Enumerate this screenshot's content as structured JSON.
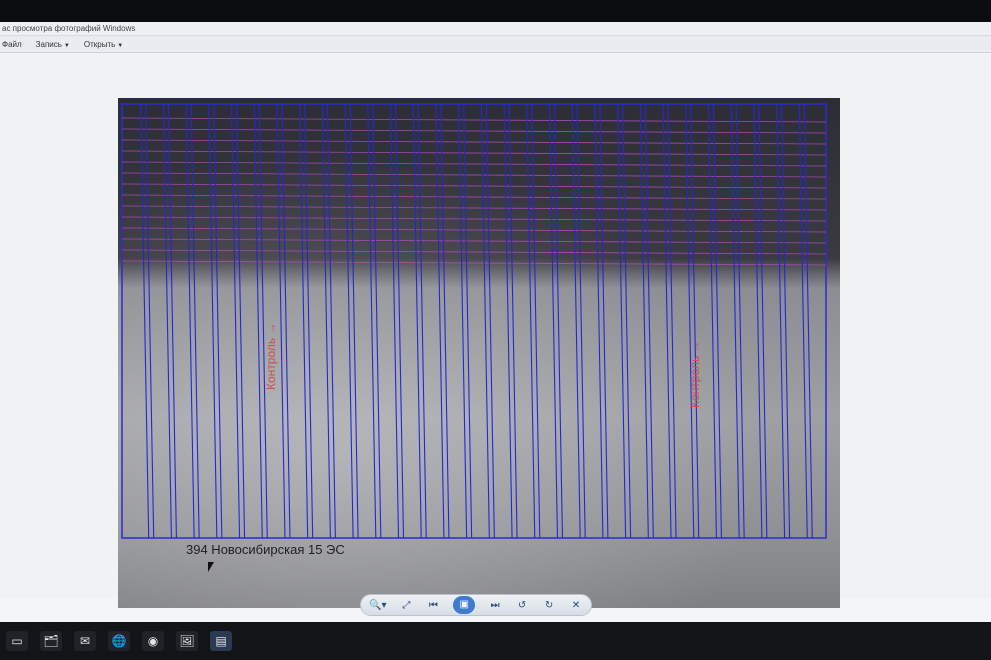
{
  "window": {
    "title": "ас просмотра фотографий Windows",
    "menu": [
      {
        "label": "Файл"
      },
      {
        "label": "Запись"
      },
      {
        "label": "Открыть"
      }
    ]
  },
  "photo": {
    "caption": "394 Новосибирская 15 ЭС",
    "annotations": [
      {
        "text": "Контроль →"
      },
      {
        "text": "Контроль →"
      }
    ]
  },
  "controls": {
    "zoom_icon": "🔍▾",
    "fit_icon": "⤢",
    "prev_icon": "⏮",
    "slideshow_icon": "▣",
    "next_icon": "⏭",
    "rotate_ccw_icon": "↺",
    "rotate_cw_icon": "↻",
    "delete_icon": "✕"
  },
  "taskbar": {
    "items": [
      {
        "icon": "▭",
        "name": "desktop-icon"
      },
      {
        "icon": "🗂",
        "name": "file-explorer-icon"
      },
      {
        "icon": "✉",
        "name": "mail-icon"
      },
      {
        "icon": "🌐",
        "name": "browser-icon"
      },
      {
        "icon": "◉",
        "name": "firefox-icon"
      },
      {
        "icon": "🖼",
        "name": "photos-icon"
      },
      {
        "icon": "▤",
        "name": "photo-viewer-icon"
      }
    ]
  }
}
